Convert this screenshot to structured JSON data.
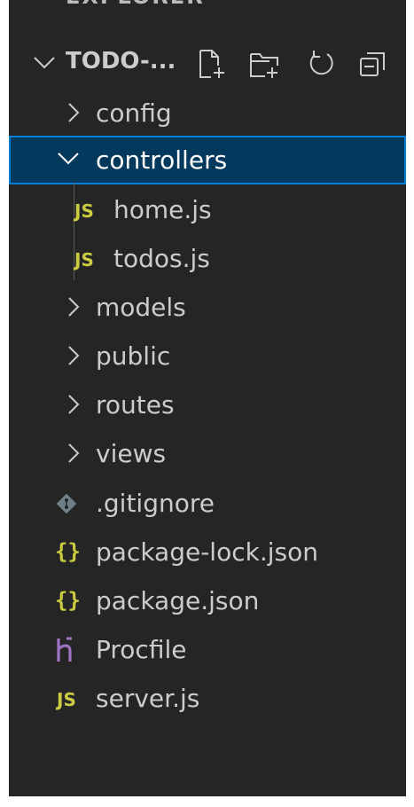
{
  "explorer": {
    "title": "EXPLORER",
    "folder": {
      "name": "TODO-...",
      "actions": [
        {
          "name": "new-file-icon"
        },
        {
          "name": "new-folder-icon"
        },
        {
          "name": "refresh-icon"
        },
        {
          "name": "collapse-all-icon"
        }
      ]
    },
    "tree": [
      {
        "label": "config",
        "kind": "folder",
        "expanded": false,
        "depth": 1
      },
      {
        "label": "controllers",
        "kind": "folder",
        "expanded": true,
        "depth": 1,
        "selected": true
      },
      {
        "label": "home.js",
        "kind": "js",
        "icon_text": "JS",
        "depth": 2
      },
      {
        "label": "todos.js",
        "kind": "js",
        "icon_text": "JS",
        "depth": 2
      },
      {
        "label": "models",
        "kind": "folder",
        "expanded": false,
        "depth": 1
      },
      {
        "label": "public",
        "kind": "folder",
        "expanded": false,
        "depth": 1
      },
      {
        "label": "routes",
        "kind": "folder",
        "expanded": false,
        "depth": 1
      },
      {
        "label": "views",
        "kind": "folder",
        "expanded": false,
        "depth": 1
      },
      {
        "label": ".gitignore",
        "kind": "git",
        "depth": 1
      },
      {
        "label": "package-lock.json",
        "kind": "json",
        "icon_text": "{}",
        "depth": 1
      },
      {
        "label": "package.json",
        "kind": "json",
        "icon_text": "{}",
        "depth": 1
      },
      {
        "label": "Procfile",
        "kind": "heroku",
        "depth": 1
      },
      {
        "label": "server.js",
        "kind": "js",
        "icon_text": "JS",
        "depth": 1
      }
    ]
  },
  "colors": {
    "sidebar_bg": "#252526",
    "text": "#cccccc",
    "selected_bg": "#04395e",
    "selected_border": "#007fd4",
    "js_yellow": "#cbcb41",
    "heroku_purple": "#a074c4",
    "git_gray": "#6d8086"
  }
}
